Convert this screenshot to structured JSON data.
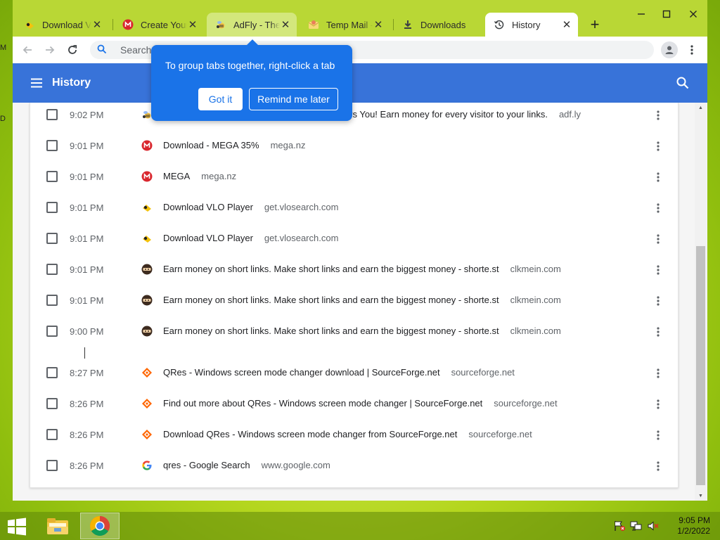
{
  "desktop": {
    "fragment_1": "M",
    "fragment_2": "D"
  },
  "browser": {
    "tabs": [
      {
        "title": "Download VLO Player",
        "favicon": "vlo-icon",
        "close": "✕"
      },
      {
        "title": "Create Your Account",
        "favicon": "mega-icon",
        "close": "✕"
      },
      {
        "title": "AdFly - The URL Shortener",
        "favicon": "adfly-icon",
        "close": "✕"
      },
      {
        "title": "Temp Mail - Disposable",
        "favicon": "temp-mail-icon",
        "close": "✕"
      },
      {
        "title": "Downloads",
        "favicon": "download-icon",
        "close": "✕"
      },
      {
        "title": "History",
        "favicon": "history-icon",
        "close": "✕",
        "active": true
      }
    ],
    "new_tab": "+",
    "omnibox": {
      "placeholder": "Search"
    },
    "window_controls": [
      "minimize",
      "maximize",
      "close"
    ]
  },
  "history_page": {
    "title": "History",
    "rows": [
      {
        "time": "9:02 PM",
        "title": "AdFly - The URL Shortener Service Which Pays You! Earn money for every visitor to your links.",
        "domain": "adf.ly",
        "favicon": "adfly-icon"
      },
      {
        "time": "9:01 PM",
        "title": "Download - MEGA 35%",
        "domain": "mega.nz",
        "favicon": "mega-icon"
      },
      {
        "time": "9:01 PM",
        "title": "MEGA",
        "domain": "mega.nz",
        "favicon": "mega-icon"
      },
      {
        "time": "9:01 PM",
        "title": "Download VLO Player",
        "domain": "get.vlosearch.com",
        "favicon": "vlo-icon"
      },
      {
        "time": "9:01 PM",
        "title": "Download VLO Player",
        "domain": "get.vlosearch.com",
        "favicon": "vlo-icon"
      },
      {
        "time": "9:01 PM",
        "title": "Earn money on short links. Make short links and earn the biggest money - shorte.st",
        "domain": "clkmein.com",
        "favicon": "shortest-icon"
      },
      {
        "time": "9:01 PM",
        "title": "Earn money on short links. Make short links and earn the biggest money - shorte.st",
        "domain": "clkmein.com",
        "favicon": "shortest-icon"
      },
      {
        "time": "9:00 PM",
        "title": "Earn money on short links. Make short links and earn the biggest money - shorte.st",
        "domain": "clkmein.com",
        "favicon": "shortest-icon"
      },
      {
        "time": "8:27 PM",
        "title": "QRes - Windows screen mode changer download | SourceForge.net",
        "domain": "sourceforge.net",
        "favicon": "sourceforge-icon"
      },
      {
        "time": "8:26 PM",
        "title": "Find out more about QRes - Windows screen mode changer | SourceForge.net",
        "domain": "sourceforge.net",
        "favicon": "sourceforge-icon"
      },
      {
        "time": "8:26 PM",
        "title": "Download QRes - Windows screen mode changer from SourceForge.net",
        "domain": "sourceforge.net",
        "favicon": "sourceforge-icon"
      },
      {
        "time": "8:26 PM",
        "title": "qres - Google Search",
        "domain": "www.google.com",
        "favicon": "google-icon"
      }
    ]
  },
  "promo_bubble": {
    "text": "To group tabs together, right-click a tab",
    "primary_button": "Got it",
    "secondary_button": "Remind me later"
  },
  "taskbar": {
    "clock_time": "9:05 PM",
    "clock_date": "1/2/2022"
  },
  "colors": {
    "app_bar": "#3873d9",
    "bubble": "#1a73e8",
    "tabstrip": "#b9d735",
    "desktop": "#b4d61e"
  }
}
